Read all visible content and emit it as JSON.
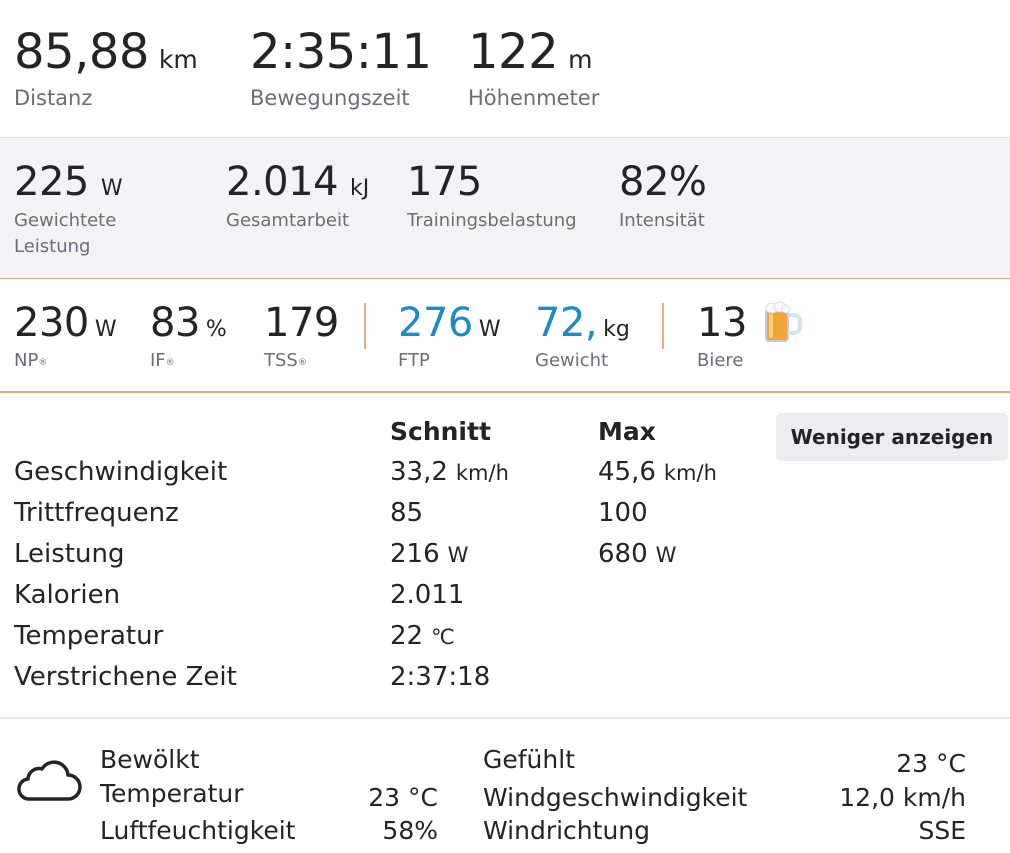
{
  "primary": {
    "distance": {
      "value": "85,88",
      "unit": "km",
      "label": "Distanz"
    },
    "moving_time": {
      "value": "2:35:11",
      "label": "Bewegungszeit"
    },
    "elevation": {
      "value": "122",
      "unit": "m",
      "label": "Höhenmeter"
    }
  },
  "secondary": {
    "weighted_power": {
      "value": "225",
      "unit": "W",
      "label_line1": "Gewichtete",
      "label_line2": "Leistung"
    },
    "total_work": {
      "value": "2.014",
      "unit": "kJ",
      "label": "Gesamtarbeit"
    },
    "training_load": {
      "value": "175",
      "label": "Trainingsbelastung"
    },
    "intensity": {
      "value": "82%",
      "label": "Intensität"
    }
  },
  "tertiary": {
    "np": {
      "value": "230",
      "unit": "W",
      "label": "NP",
      "mark": "®"
    },
    "if": {
      "value": "83",
      "unit": "%",
      "label": "IF",
      "mark": "®"
    },
    "tss": {
      "value": "179",
      "label": "TSS",
      "mark": "®"
    },
    "ftp": {
      "value": "276",
      "unit": "W",
      "label": "FTP"
    },
    "weight": {
      "value": "72,",
      "unit": "kg",
      "label": "Gewicht"
    },
    "beers": {
      "value": "13",
      "label": "Biere",
      "icon": "beer-mug-icon"
    }
  },
  "stats": {
    "header_avg": "Schnitt",
    "header_max": "Max",
    "toggle_label": "Weniger anzeigen",
    "rows": [
      {
        "label": "Geschwindigkeit",
        "avg": "33,2",
        "avg_unit": "km/h",
        "max": "45,6",
        "max_unit": "km/h"
      },
      {
        "label": "Trittfrequenz",
        "avg": "85",
        "avg_unit": "",
        "max": "100",
        "max_unit": ""
      },
      {
        "label": "Leistung",
        "avg": "216",
        "avg_unit": "W",
        "max": "680",
        "max_unit": "W"
      },
      {
        "label": "Kalorien",
        "avg": "2.011",
        "avg_unit": "",
        "max": "",
        "max_unit": ""
      },
      {
        "label": "Temperatur",
        "avg": "22",
        "avg_unit": "℃",
        "max": "",
        "max_unit": ""
      },
      {
        "label": "Verstrichene Zeit",
        "avg": "2:37:18",
        "avg_unit": "",
        "max": "",
        "max_unit": ""
      }
    ]
  },
  "weather": {
    "icon": "cloud-icon",
    "condition": "Bewölkt",
    "temperature_label": "Temperatur",
    "temperature_value": "23 °C",
    "humidity_label": "Luftfeuchtigkeit",
    "humidity_value": "58%",
    "feels_label": "Gefühlt",
    "feels_value": "23 °C",
    "wind_speed_label": "Windgeschwindigkeit",
    "wind_speed_value": "12,0 km/h",
    "wind_dir_label": "Windrichtung",
    "wind_dir_value": "SSE"
  },
  "colors": {
    "accent_blue": "#1e8bc3",
    "separator_orange": "#f0a982"
  }
}
